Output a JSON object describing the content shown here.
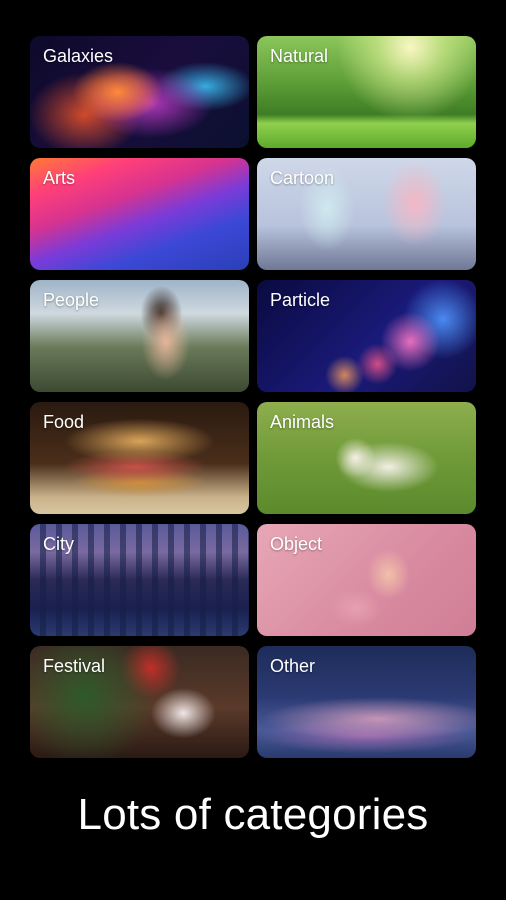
{
  "categories": [
    {
      "label": "Galaxies"
    },
    {
      "label": "Natural"
    },
    {
      "label": "Arts"
    },
    {
      "label": "Cartoon"
    },
    {
      "label": "People"
    },
    {
      "label": "Particle"
    },
    {
      "label": "Food"
    },
    {
      "label": "Animals"
    },
    {
      "label": "City"
    },
    {
      "label": "Object"
    },
    {
      "label": "Festival"
    },
    {
      "label": "Other"
    }
  ],
  "caption": "Lots of categories"
}
